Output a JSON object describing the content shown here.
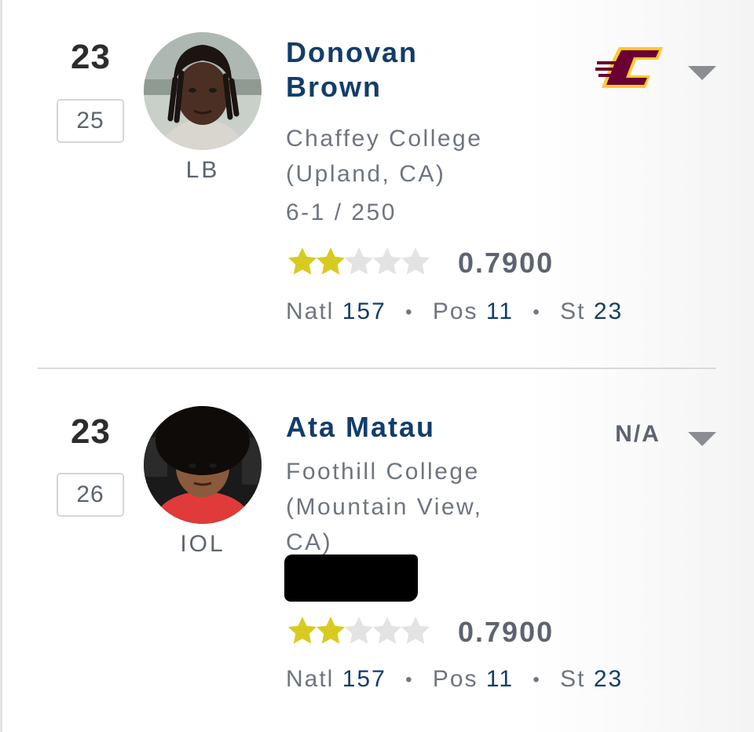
{
  "recruits": [
    {
      "rank": "23",
      "sub_rank": "25",
      "position": "LB",
      "name_line1": "Donovan",
      "name_line2": "Brown",
      "school_line1": "Chaffey College",
      "school_line2": "(Upland, CA)",
      "measurements": "6-1 / 250",
      "stars": 2,
      "stars_max": 5,
      "rating": "0.7900",
      "natl_label": "Natl",
      "natl_rank": "157",
      "pos_label": "Pos",
      "pos_rank": "11",
      "st_label": "St",
      "st_rank": "23",
      "commit": {
        "type": "logo",
        "icon": "central-michigan-logo-icon",
        "color_primary": "#6a0032",
        "color_secondary": "#ffc82e"
      }
    },
    {
      "rank": "23",
      "sub_rank": "26",
      "position": "IOL",
      "name_line1": "Ata Matau",
      "school_line1": "Foothill College",
      "school_line2": "(Mountain View,",
      "school_line3": "CA)",
      "measurements_redacted": true,
      "stars": 2,
      "stars_max": 5,
      "rating": "0.7900",
      "natl_label": "Natl",
      "natl_rank": "157",
      "pos_label": "Pos",
      "pos_rank": "11",
      "st_label": "St",
      "st_rank": "23",
      "commit": {
        "type": "text",
        "label": "N/A"
      }
    }
  ],
  "colors": {
    "name_blue": "#123d6b",
    "star_filled": "#d8cb1f",
    "star_empty": "#e3e3e3",
    "gray_text": "#6e7580"
  },
  "icons": {
    "dropdown": "caret-down-icon",
    "star": "star-icon"
  }
}
